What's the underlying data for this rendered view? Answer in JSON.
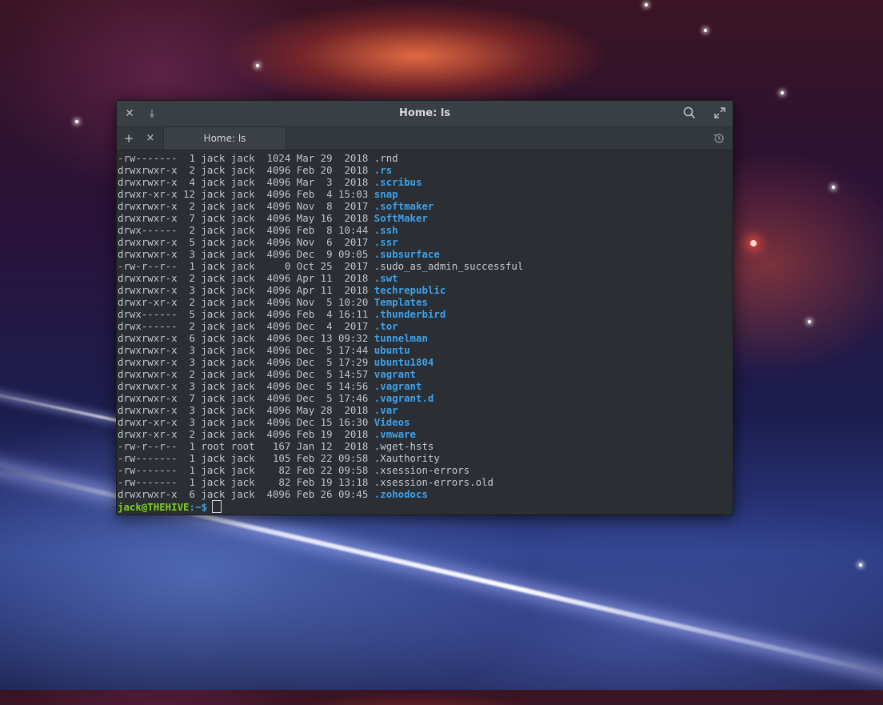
{
  "window": {
    "title": "Home: ls",
    "close_icon": "close-icon",
    "download_icon": "download-icon",
    "search_icon": "search-icon",
    "fullscreen_icon": "fullscreen-icon"
  },
  "tabs": {
    "add_label": "+",
    "close_label": "×",
    "active_tab_label": "Home: ls",
    "history_icon": "history-icon"
  },
  "listing": [
    {
      "meta": "-rw-------  1 jack jack  1024 Mar 29  2018 ",
      "name": ".rnd",
      "type": "file"
    },
    {
      "meta": "drwxrwxr-x  2 jack jack  4096 Feb 20  2018 ",
      "name": ".rs",
      "type": "dir"
    },
    {
      "meta": "drwxrwxr-x  4 jack jack  4096 Mar  3  2018 ",
      "name": ".scribus",
      "type": "dir"
    },
    {
      "meta": "drwxr-xr-x 12 jack jack  4096 Feb  4 15:03 ",
      "name": "snap",
      "type": "dir"
    },
    {
      "meta": "drwxrwxr-x  2 jack jack  4096 Nov  8  2017 ",
      "name": ".softmaker",
      "type": "dir"
    },
    {
      "meta": "drwxrwxr-x  7 jack jack  4096 May 16  2018 ",
      "name": "SoftMaker",
      "type": "dir"
    },
    {
      "meta": "drwx------  2 jack jack  4096 Feb  8 10:44 ",
      "name": ".ssh",
      "type": "dir"
    },
    {
      "meta": "drwxrwxr-x  5 jack jack  4096 Nov  6  2017 ",
      "name": ".ssr",
      "type": "dir"
    },
    {
      "meta": "drwxrwxr-x  3 jack jack  4096 Dec  9 09:05 ",
      "name": ".subsurface",
      "type": "dir"
    },
    {
      "meta": "-rw-r--r--  1 jack jack     0 Oct 25  2017 ",
      "name": ".sudo_as_admin_successful",
      "type": "file"
    },
    {
      "meta": "drwxrwxr-x  2 jack jack  4096 Apr 11  2018 ",
      "name": ".swt",
      "type": "dir"
    },
    {
      "meta": "drwxrwxr-x  3 jack jack  4096 Apr 11  2018 ",
      "name": "techrepublic",
      "type": "dir"
    },
    {
      "meta": "drwxr-xr-x  2 jack jack  4096 Nov  5 10:20 ",
      "name": "Templates",
      "type": "dir"
    },
    {
      "meta": "drwx------  5 jack jack  4096 Feb  4 16:11 ",
      "name": ".thunderbird",
      "type": "dir"
    },
    {
      "meta": "drwx------  2 jack jack  4096 Dec  4  2017 ",
      "name": ".tor",
      "type": "dir"
    },
    {
      "meta": "drwxrwxr-x  6 jack jack  4096 Dec 13 09:32 ",
      "name": "tunnelman",
      "type": "dir"
    },
    {
      "meta": "drwxrwxr-x  3 jack jack  4096 Dec  5 17:44 ",
      "name": "ubuntu",
      "type": "dir"
    },
    {
      "meta": "drwxrwxr-x  3 jack jack  4096 Dec  5 17:29 ",
      "name": "ubuntu1804",
      "type": "dir"
    },
    {
      "meta": "drwxrwxr-x  2 jack jack  4096 Dec  5 14:57 ",
      "name": "vagrant",
      "type": "dir"
    },
    {
      "meta": "drwxrwxr-x  3 jack jack  4096 Dec  5 14:56 ",
      "name": ".vagrant",
      "type": "dir"
    },
    {
      "meta": "drwxrwxr-x  7 jack jack  4096 Dec  5 17:46 ",
      "name": ".vagrant.d",
      "type": "dir"
    },
    {
      "meta": "drwxrwxr-x  3 jack jack  4096 May 28  2018 ",
      "name": ".var",
      "type": "dir"
    },
    {
      "meta": "drwxr-xr-x  3 jack jack  4096 Dec 15 16:30 ",
      "name": "Videos",
      "type": "dir"
    },
    {
      "meta": "drwxr-xr-x  2 jack jack  4096 Feb 19  2018 ",
      "name": ".vmware",
      "type": "dir"
    },
    {
      "meta": "-rw-r--r--  1 root root   167 Jan 12  2018 ",
      "name": ".wget-hsts",
      "type": "file"
    },
    {
      "meta": "-rw-------  1 jack jack   105 Feb 22 09:58 ",
      "name": ".Xauthority",
      "type": "file"
    },
    {
      "meta": "-rw-------  1 jack jack    82 Feb 22 09:58 ",
      "name": ".xsession-errors",
      "type": "file"
    },
    {
      "meta": "-rw-------  1 jack jack    82 Feb 19 13:18 ",
      "name": ".xsession-errors.old",
      "type": "file"
    },
    {
      "meta": "drwxrwxr-x  6 jack jack  4096 Feb 26 09:45 ",
      "name": ".zohodocs",
      "type": "dir"
    }
  ],
  "prompt": {
    "user_host": "jack@THEHIVE",
    "path": ":~$"
  },
  "colors": {
    "directory": "#3fa0e8",
    "prompt_user": "#7fcf25",
    "text": "#bfc4c8",
    "background": "#2b2f33"
  }
}
